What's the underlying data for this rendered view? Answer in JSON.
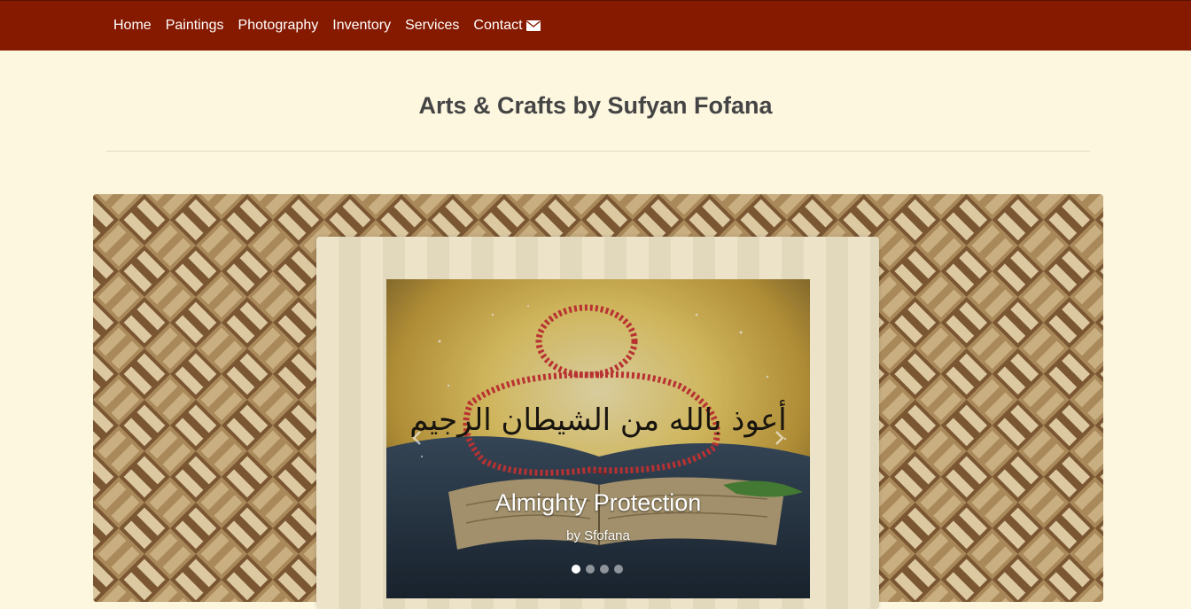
{
  "nav": {
    "items": [
      {
        "label": "Home"
      },
      {
        "label": "Paintings"
      },
      {
        "label": "Photography"
      },
      {
        "label": "Inventory"
      },
      {
        "label": "Services"
      },
      {
        "label": "Contact"
      }
    ],
    "contact_icon": "envelope-icon"
  },
  "page": {
    "title": "Arts & Crafts by Sufyan Fofana"
  },
  "carousel": {
    "slide_title": "Almighty Protection",
    "slide_subtitle": "by Sfofana",
    "slide_count": 4,
    "active_index": 0,
    "painting_text": "أعوذ بالله من الشيطان الرجيم",
    "prev_icon": "chevron-left-icon",
    "next_icon": "chevron-right-icon"
  },
  "colors": {
    "navbar": "#861a00",
    "background": "#fdf7e0",
    "title_text": "#444444",
    "weave_light": "#dcc9a2",
    "weave_mid": "#a9895a",
    "weave_dark": "#7a5632"
  }
}
